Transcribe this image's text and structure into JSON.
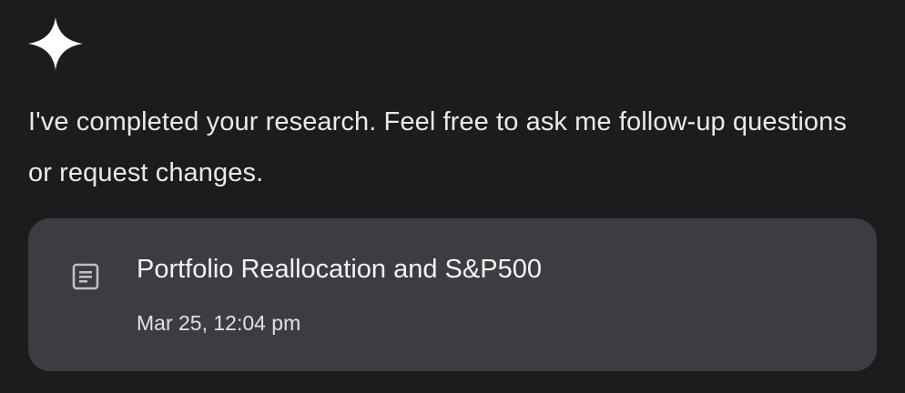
{
  "assistant": {
    "avatar_icon": "sparkle-icon",
    "message": "I've completed your research. Feel free to ask me follow-up questions or request changes."
  },
  "report_card": {
    "icon": "document-icon",
    "title": "Portfolio Reallocation and S&P500",
    "date": "Mar 25, 12:04 pm"
  },
  "colors": {
    "background": "#1c1c1e",
    "card": "#3c3d41",
    "text": "#e8eaed"
  }
}
